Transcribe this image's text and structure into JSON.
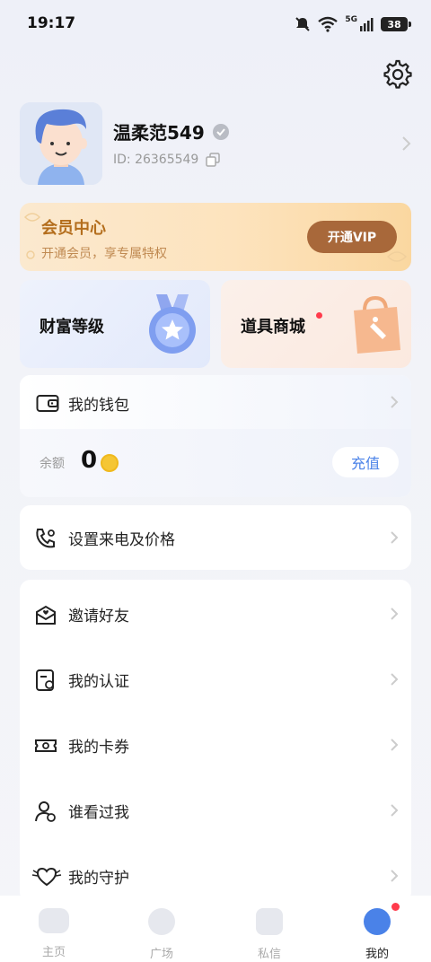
{
  "status_bar": {
    "time": "19:17",
    "battery": "38",
    "network": "5G"
  },
  "profile": {
    "username": "温柔范549",
    "id_text": "ID: 26365549"
  },
  "vip": {
    "title": "会员中心",
    "subtitle": "开通会员，享专属特权",
    "button": "开通VIP"
  },
  "features": {
    "wealth": "财富等级",
    "shop": "道具商城"
  },
  "wallet": {
    "title": "我的钱包",
    "balance_label": "余额",
    "balance_value": "0",
    "recharge": "充值"
  },
  "call_settings": {
    "label": "设置来电及价格"
  },
  "menu": [
    {
      "label": "邀请好友",
      "icon": "invite-icon"
    },
    {
      "label": "我的认证",
      "icon": "certificate-icon"
    },
    {
      "label": "我的卡券",
      "icon": "ticket-icon"
    },
    {
      "label": "谁看过我",
      "icon": "visitor-icon"
    },
    {
      "label": "我的守护",
      "icon": "guard-icon"
    }
  ],
  "tabs": [
    {
      "label": "主页",
      "active": false
    },
    {
      "label": "广场",
      "active": false
    },
    {
      "label": "私信",
      "active": false
    },
    {
      "label": "我的",
      "active": true
    }
  ],
  "colors": {
    "accent": "#4a82e8",
    "vip_brown": "#a8683a",
    "badge_red": "#ff3b4c"
  }
}
